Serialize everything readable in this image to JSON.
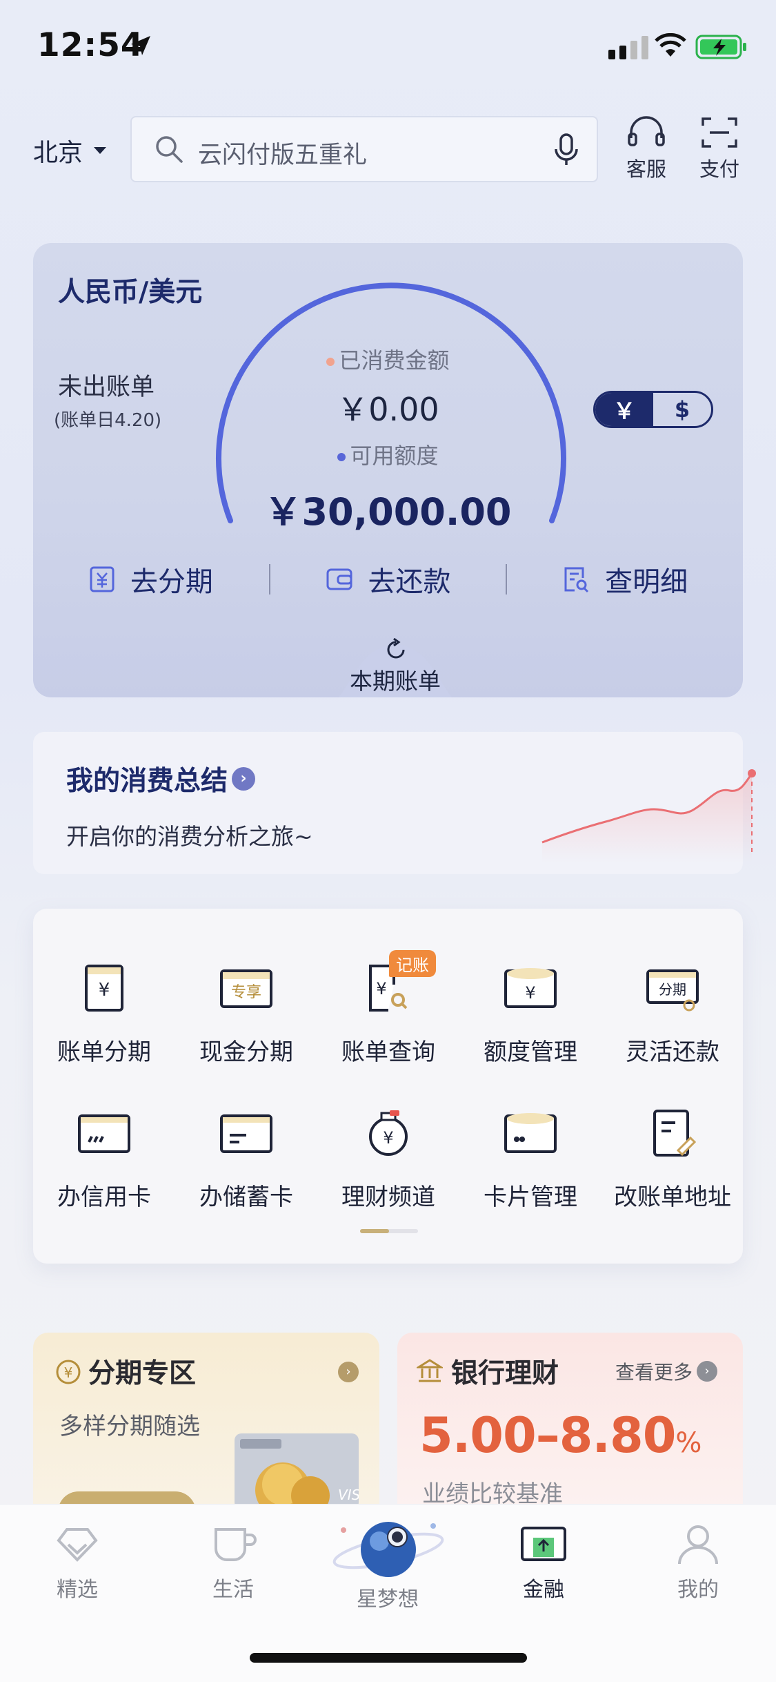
{
  "status_bar": {
    "time": "12:54"
  },
  "header": {
    "city": "北京",
    "search_placeholder": "云闪付版五重礼",
    "service_label": "客服",
    "pay_label": "支付"
  },
  "credit_panel": {
    "currency_pair": "人民币/美元",
    "bill_status": "未出账单",
    "bill_day": "(账单日4.20)",
    "spent_label": "已消费金额",
    "spent_value": "￥0.00",
    "available_label": "可用额度",
    "available_value": "￥30,000.00",
    "currency_toggle": {
      "yuan": "￥",
      "usd": "$",
      "selected": "yuan"
    },
    "actions": [
      {
        "label": "去分期",
        "icon": "installment-icon"
      },
      {
        "label": "去还款",
        "icon": "wallet-icon"
      },
      {
        "label": "查明细",
        "icon": "detail-icon"
      }
    ],
    "current_bill_label": "本期账单",
    "arc_color": "#5466dc"
  },
  "summary": {
    "title": "我的消费总结",
    "subtitle": "开启你的消费分析之旅~",
    "line_color": "#ea6f73"
  },
  "services": {
    "row1": [
      "账单分期",
      "现金分期",
      "账单查询",
      "额度管理",
      "灵活还款"
    ],
    "row2": [
      "办信用卡",
      "办储蓄卡",
      "理财频道",
      "卡片管理",
      "改账单地址"
    ],
    "badge": "记账",
    "icon_texts": {
      "exclusive": "专享",
      "installment": "分期"
    }
  },
  "promo_left": {
    "title": "分期专区",
    "subtitle": "多样分期随选"
  },
  "promo_right": {
    "title": "银行理财",
    "more": "查看更多",
    "rate": "5.00–8.80",
    "rate_unit": "%",
    "subtitle": "业绩比较基准",
    "accent": "#e3623e"
  },
  "tabbar": {
    "items": [
      "精选",
      "生活",
      "星梦想",
      "金融",
      "我的"
    ],
    "active": "金融"
  }
}
